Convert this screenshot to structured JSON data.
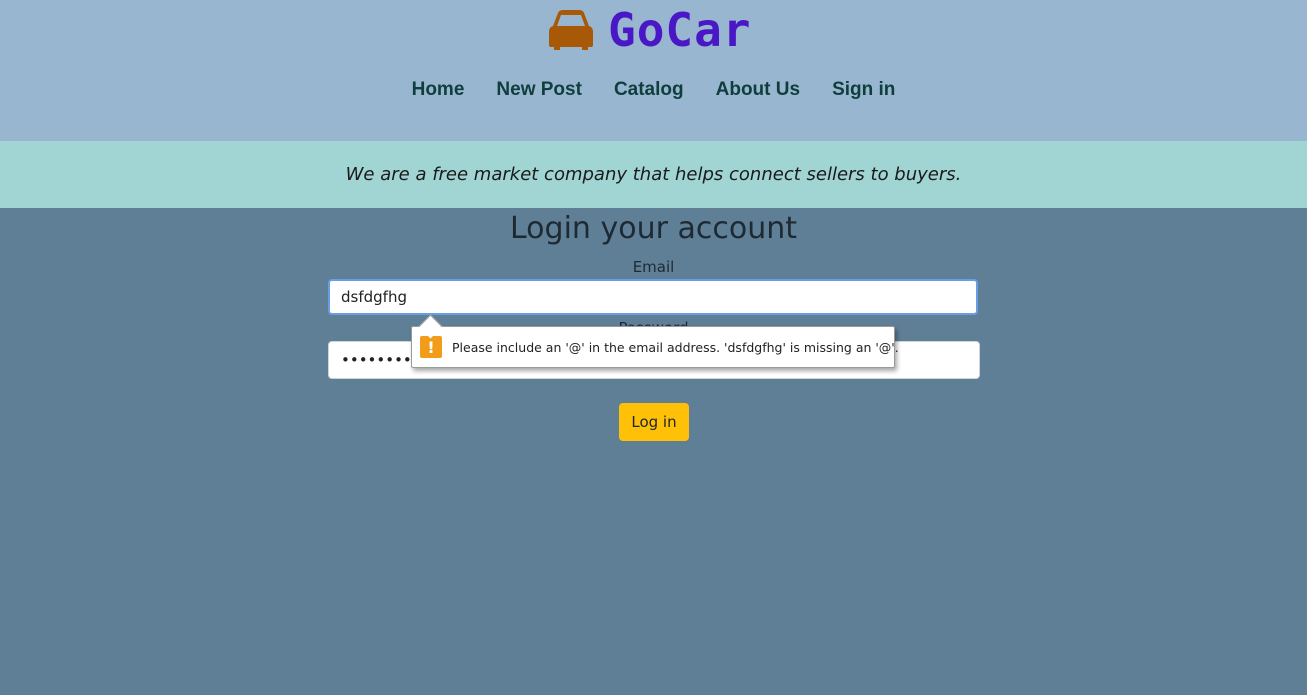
{
  "brand": {
    "name": "GoCar",
    "logo_icon": "car-icon",
    "logo_color": "#a75907",
    "text_color": "#4a17c6"
  },
  "nav": {
    "items": [
      {
        "label": "Home"
      },
      {
        "label": "New Post"
      },
      {
        "label": "Catalog"
      },
      {
        "label": "About Us"
      },
      {
        "label": "Sign in"
      }
    ]
  },
  "tagline": "We are a free market company that helps connect sellers to buyers.",
  "login": {
    "title": "Login your account",
    "email_label": "Email",
    "email_value": "dsfdgfhg",
    "password_label": "Password",
    "password_value": "•••••••••••",
    "button_label": "Log in"
  },
  "validation_tooltip": {
    "icon": "warning-icon",
    "icon_glyph": "!",
    "message": "Please include an '@' in the email address. 'dsfdgfhg' is missing an '@'."
  },
  "colors": {
    "header_bg": "#98b6d0",
    "tagline_bg": "#a1d5d3",
    "page_bg": "#5f7f96",
    "button_bg": "#ffc107",
    "warning": "#f29d1a"
  }
}
